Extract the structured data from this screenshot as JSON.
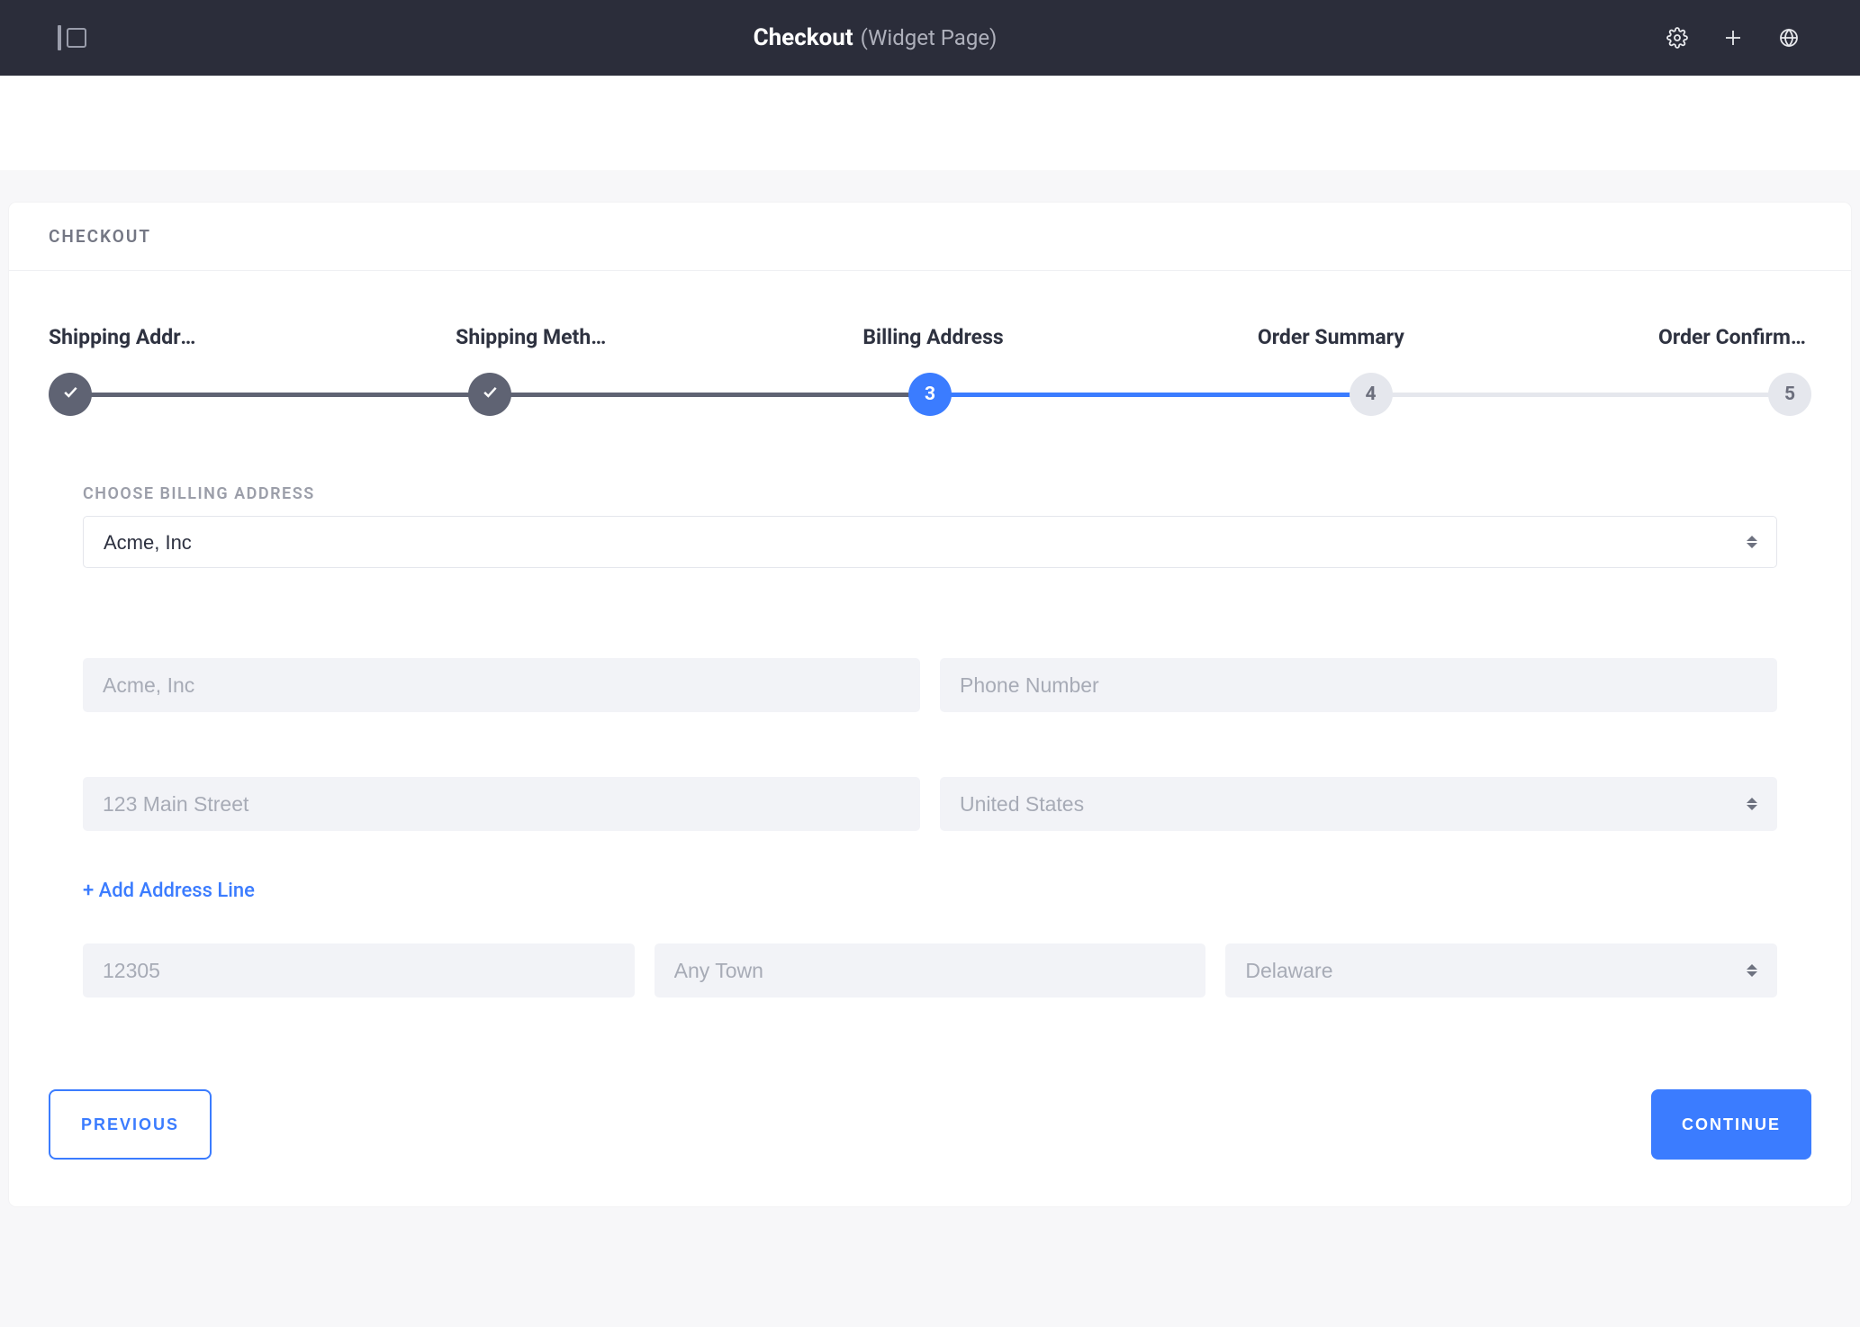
{
  "header": {
    "title": "Checkout",
    "subtitle": "(Widget Page)"
  },
  "card": {
    "title": "CHECKOUT"
  },
  "steps": {
    "s1": "Shipping Address",
    "s2": "Shipping Method",
    "s3": "Billing Address",
    "s4": "Order Summary",
    "s5": "Order Confirmation",
    "n3": "3",
    "n4": "4",
    "n5": "5"
  },
  "form": {
    "choose_label": "CHOOSE BILLING ADDRESS",
    "choose_value": "Acme, Inc",
    "company_ph": "Acme, Inc",
    "phone_ph": "Phone Number",
    "street_ph": "123 Main Street",
    "country_value": "United States",
    "add_line": "+ Add Address Line",
    "zip_ph": "12305",
    "city_ph": "Any Town",
    "state_value": "Delaware"
  },
  "buttons": {
    "previous": "PREVIOUS",
    "continue": "CONTINUE"
  }
}
